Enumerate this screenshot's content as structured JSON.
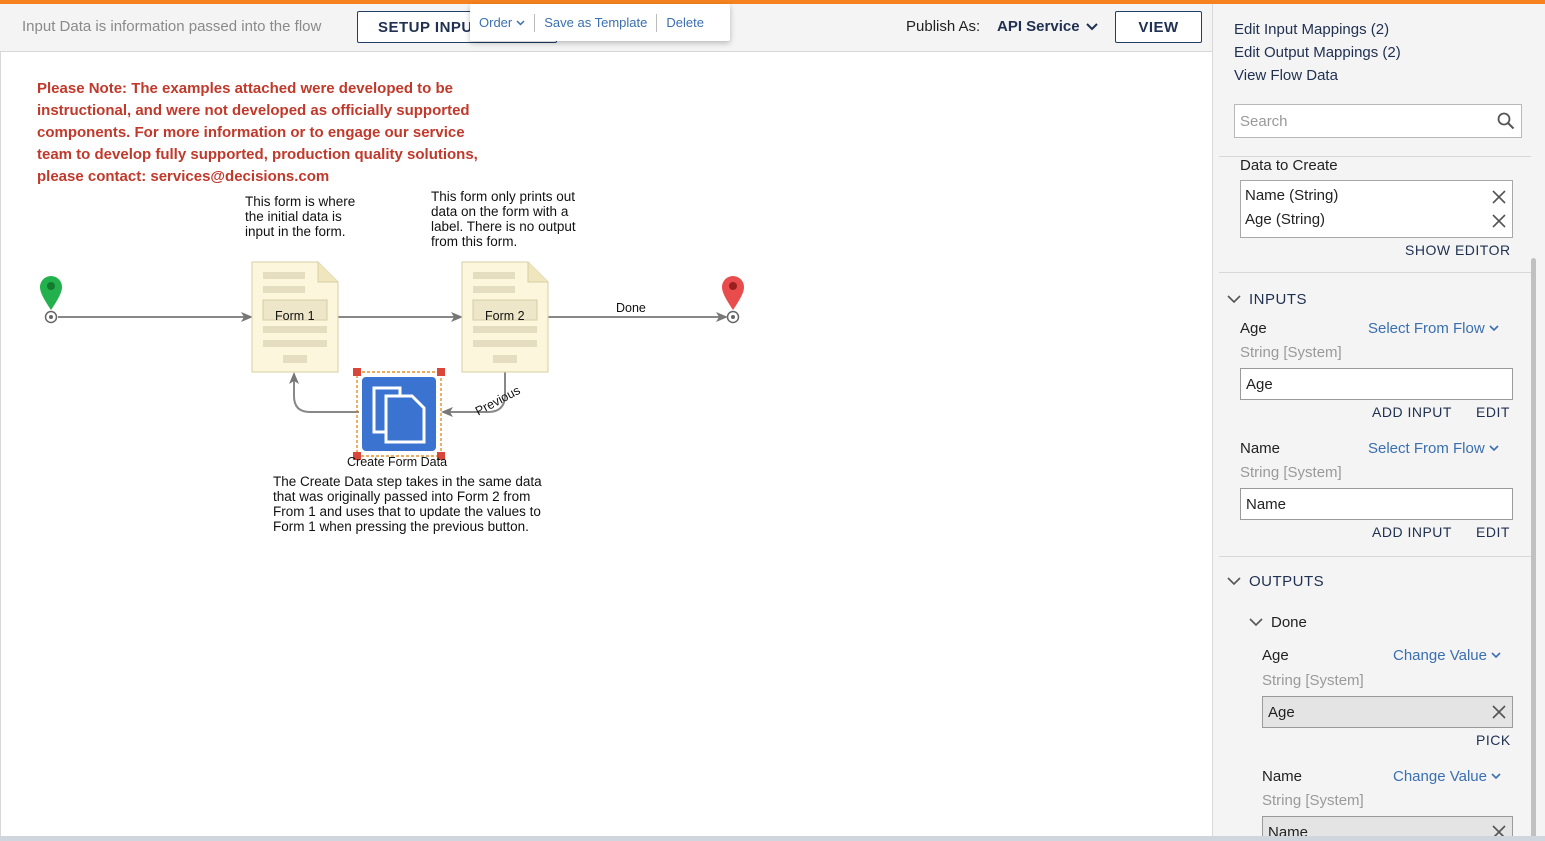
{
  "toolbar": {
    "hint": "Input Data is information passed into the flow",
    "setup_button": "SETUP INPUT",
    "publish_label": "Publish As:",
    "publish_value": "API Service",
    "view_button": "VIEW"
  },
  "popup_menu": {
    "order": "Order",
    "save_template": "Save as Template",
    "delete": "Delete"
  },
  "canvas": {
    "note": "Please Note: The examples attached were developed to be instructional, and were not developed as officially supported components.  For more information or to engage our service team to develop fully supported, production quality solutions, please contact: services@decisions.com",
    "annotation_form1": "This form is where the initial data is input in the form.",
    "annotation_form2": "This form only prints out data on the form with a label. There is no output from this form.",
    "annotation_create": "The Create Data step takes in the same data that was originally passed into Form 2 from From 1 and uses that to update the values to Form 1 when pressing the previous button.",
    "form1_label": "Form 1",
    "form2_label": "Form 2",
    "create_step_label": "Create Form Data",
    "done_label": "Done",
    "previous_label": "Previous"
  },
  "panel": {
    "links": [
      "Edit Input Mappings (2)",
      "Edit Output Mappings (2)",
      "View Flow Data"
    ],
    "search_placeholder": "Search",
    "data_to_create_label": "Data to Create",
    "data_items": [
      "Name (String)",
      "Age (String)"
    ],
    "show_editor": "SHOW EDITOR",
    "inputs_section": "INPUTS",
    "inputs": [
      {
        "name": "Age",
        "select": "Select From Flow",
        "type": "String [System]",
        "value": "Age",
        "add": "ADD INPUT",
        "edit": "EDIT"
      },
      {
        "name": "Name",
        "select": "Select From Flow",
        "type": "String [System]",
        "value": "Name",
        "add": "ADD INPUT",
        "edit": "EDIT"
      }
    ],
    "outputs_section": "OUTPUTS",
    "outputs_done": "Done",
    "outputs": [
      {
        "name": "Age",
        "select": "Change Value",
        "type": "String [System]",
        "value": "Age",
        "pick": "PICK"
      },
      {
        "name": "Name",
        "select": "Change Value",
        "type": "String [System]",
        "value": "Name"
      }
    ]
  },
  "colors": {
    "accent_orange": "#f5821f",
    "note_red": "#c0392b",
    "navy": "#1f3050",
    "link_blue": "#3a6fb0",
    "start_green": "#22b14c",
    "end_red": "#e84c4c",
    "step_blue": "#3b73d1"
  }
}
